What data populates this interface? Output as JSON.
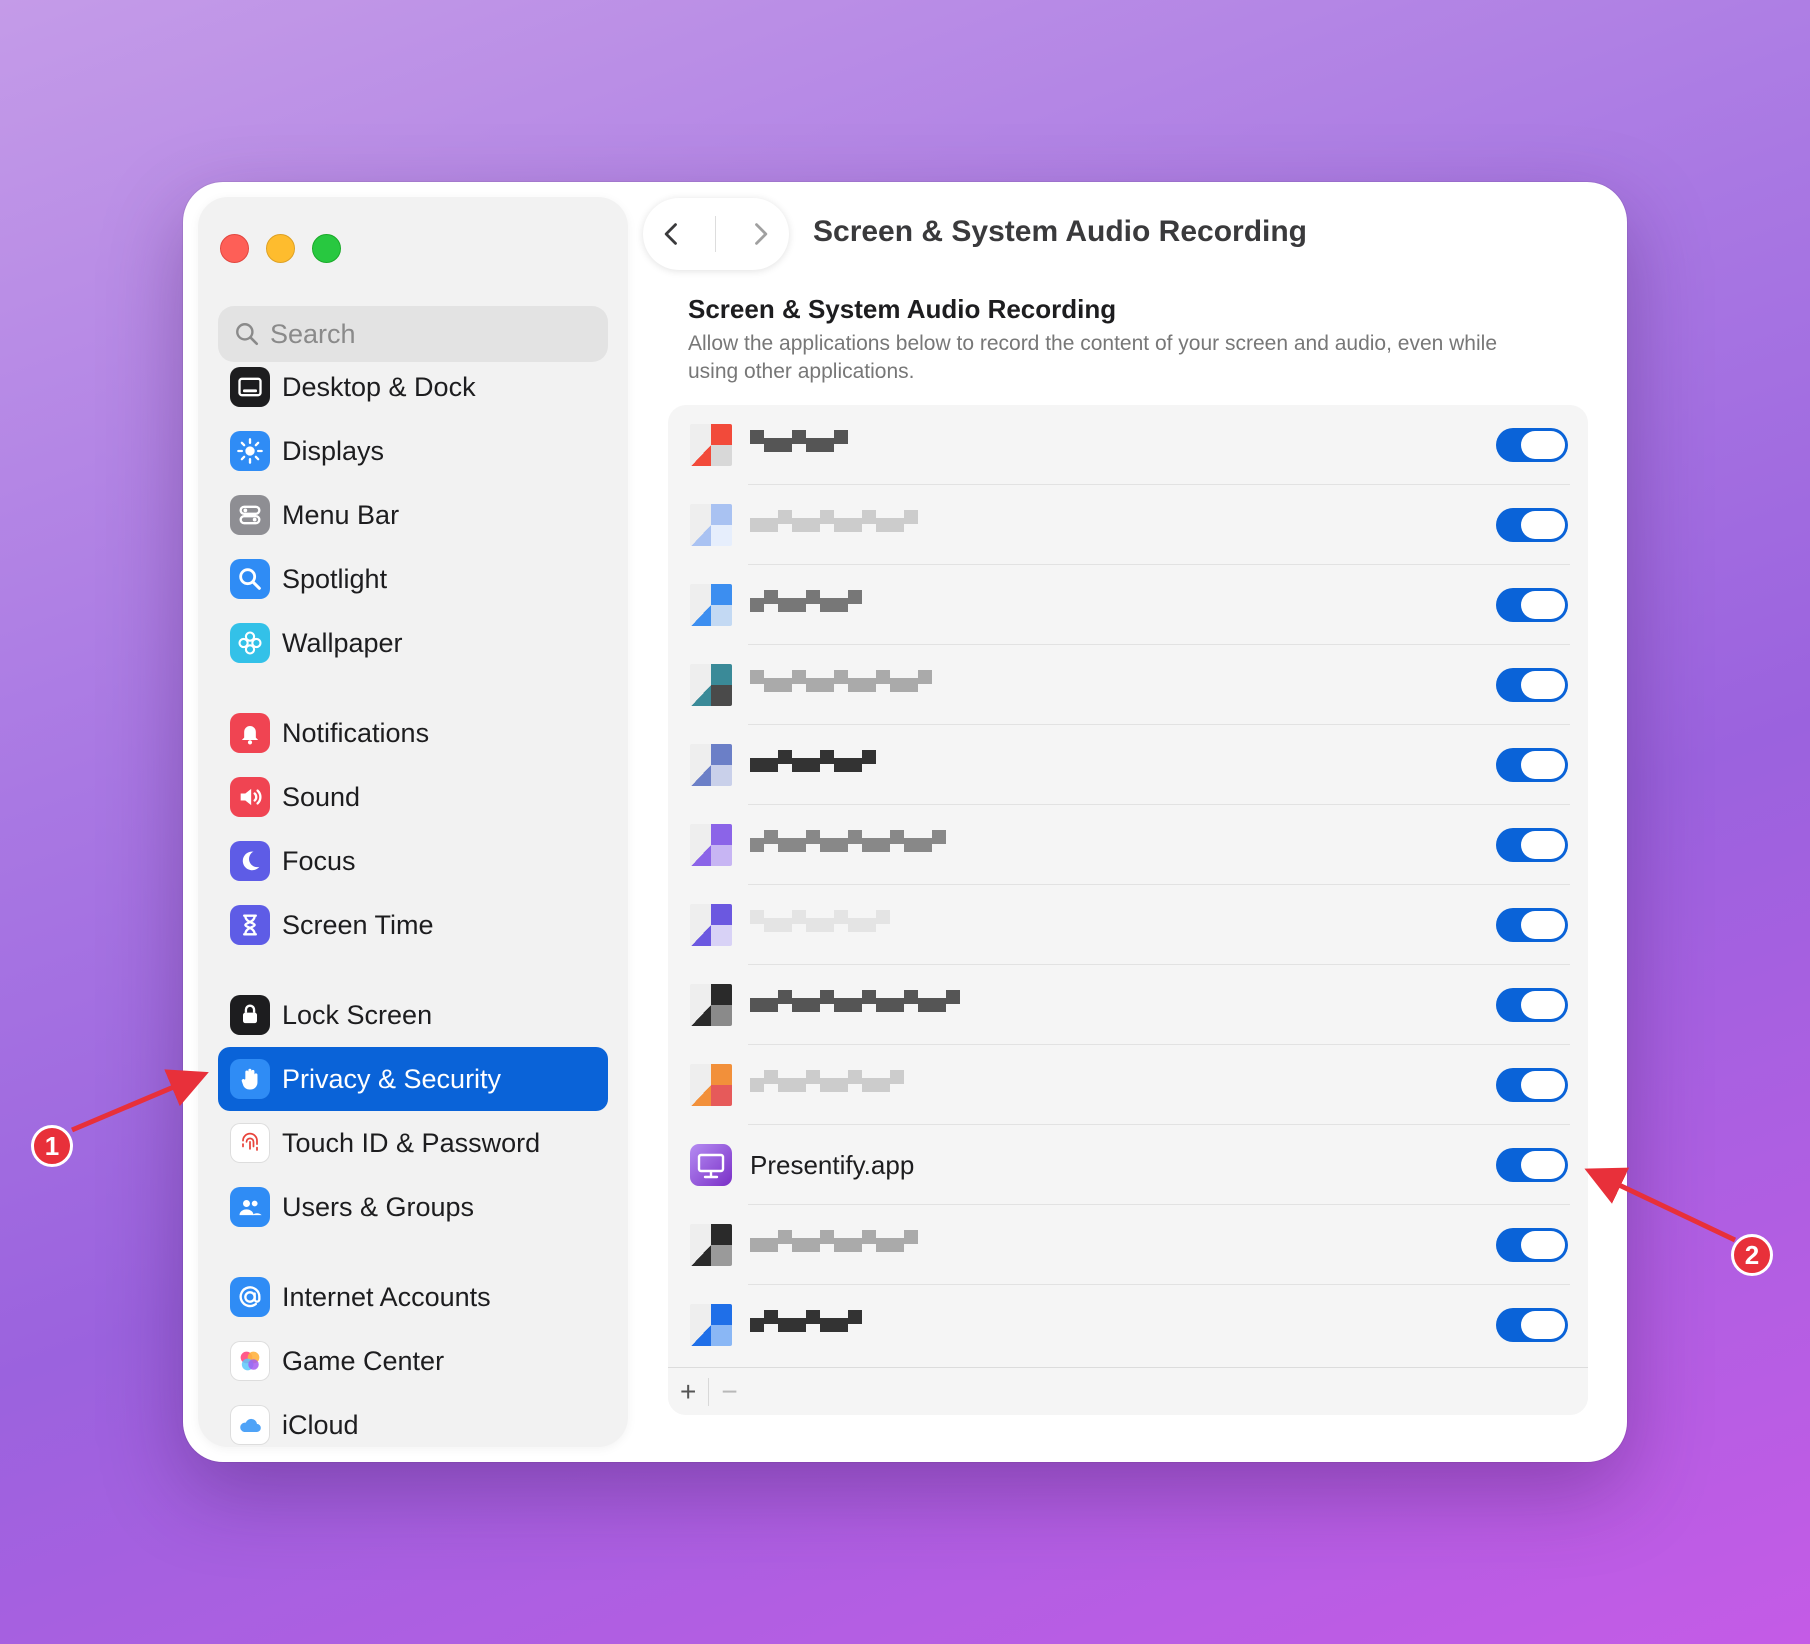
{
  "window": {
    "title": "Screen & System Audio Recording"
  },
  "search": {
    "placeholder": "Search"
  },
  "sidebar": {
    "groups": [
      [
        {
          "label": "Desktop & Dock",
          "icon": "desktop-dock-icon",
          "color": "#1d1d1f"
        },
        {
          "label": "Displays",
          "icon": "displays-icon",
          "color": "#2f8cf5"
        },
        {
          "label": "Menu Bar",
          "icon": "menu-bar-icon",
          "color": "#8e8e93"
        },
        {
          "label": "Spotlight",
          "icon": "spotlight-icon",
          "color": "#2f8cf5"
        },
        {
          "label": "Wallpaper",
          "icon": "wallpaper-icon",
          "color": "#33c1e8"
        }
      ],
      [
        {
          "label": "Notifications",
          "icon": "notifications-icon",
          "color": "#f04452"
        },
        {
          "label": "Sound",
          "icon": "sound-icon",
          "color": "#f04452"
        },
        {
          "label": "Focus",
          "icon": "focus-icon",
          "color": "#5e5ce6"
        },
        {
          "label": "Screen Time",
          "icon": "screen-time-icon",
          "color": "#5e5ce6"
        }
      ],
      [
        {
          "label": "Lock Screen",
          "icon": "lock-screen-icon",
          "color": "#1d1d1f"
        },
        {
          "label": "Privacy & Security",
          "icon": "privacy-hand-icon",
          "color": "#2f8cf5",
          "active": true
        },
        {
          "label": "Touch ID & Password",
          "icon": "fingerprint-icon",
          "color": "#ffffff"
        },
        {
          "label": "Users & Groups",
          "icon": "users-groups-icon",
          "color": "#2f8cf5"
        }
      ],
      [
        {
          "label": "Internet Accounts",
          "icon": "internet-accounts-icon",
          "color": "#2f8cf5"
        },
        {
          "label": "Game Center",
          "icon": "game-center-icon",
          "color": "#ffffff"
        },
        {
          "label": "iCloud",
          "icon": "icloud-icon",
          "color": "#ffffff"
        }
      ]
    ]
  },
  "section": {
    "title": "Screen & System Audio Recording",
    "description": "Allow the applications below to record the content of your screen and audio, even while using other applications."
  },
  "apps": [
    {
      "name": "",
      "enabled": true,
      "icon_colors": [
        "#f24a3a",
        "#d8d8d8"
      ]
    },
    {
      "name": "",
      "enabled": true,
      "icon_colors": [
        "#a9c2f2",
        "#e6eefc"
      ]
    },
    {
      "name": "",
      "enabled": true,
      "icon_colors": [
        "#3c8ef0",
        "#c3d9f3"
      ]
    },
    {
      "name": "",
      "enabled": true,
      "icon_colors": [
        "#3a8a98",
        "#4a4a4a"
      ]
    },
    {
      "name": "",
      "enabled": true,
      "icon_colors": [
        "#6b7fc7",
        "#c9d0ea"
      ]
    },
    {
      "name": "",
      "enabled": true,
      "icon_colors": [
        "#8b64e8",
        "#c7b5f3"
      ]
    },
    {
      "name": "",
      "enabled": true,
      "icon_colors": [
        "#6b58e0",
        "#d8d2f6"
      ]
    },
    {
      "name": "",
      "enabled": true,
      "icon_colors": [
        "#2a2a2a",
        "#8a8a8a"
      ]
    },
    {
      "name": "",
      "enabled": true,
      "icon_colors": [
        "#f2903a",
        "#e65a5a"
      ]
    },
    {
      "name": "Presentify.app",
      "enabled": true,
      "icon_colors": [
        "#7a2fc7",
        "#b58cf2"
      ]
    },
    {
      "name": "",
      "enabled": true,
      "icon_colors": [
        "#2a2a2a",
        "#9a9a9a"
      ]
    },
    {
      "name": "",
      "enabled": true,
      "icon_colors": [
        "#1f6fe8",
        "#8ab7f5"
      ]
    }
  ],
  "footer": {
    "add": "+",
    "remove": "−"
  },
  "annotations": [
    {
      "label": "1"
    },
    {
      "label": "2"
    }
  ],
  "accent_color": "#0a63d8"
}
